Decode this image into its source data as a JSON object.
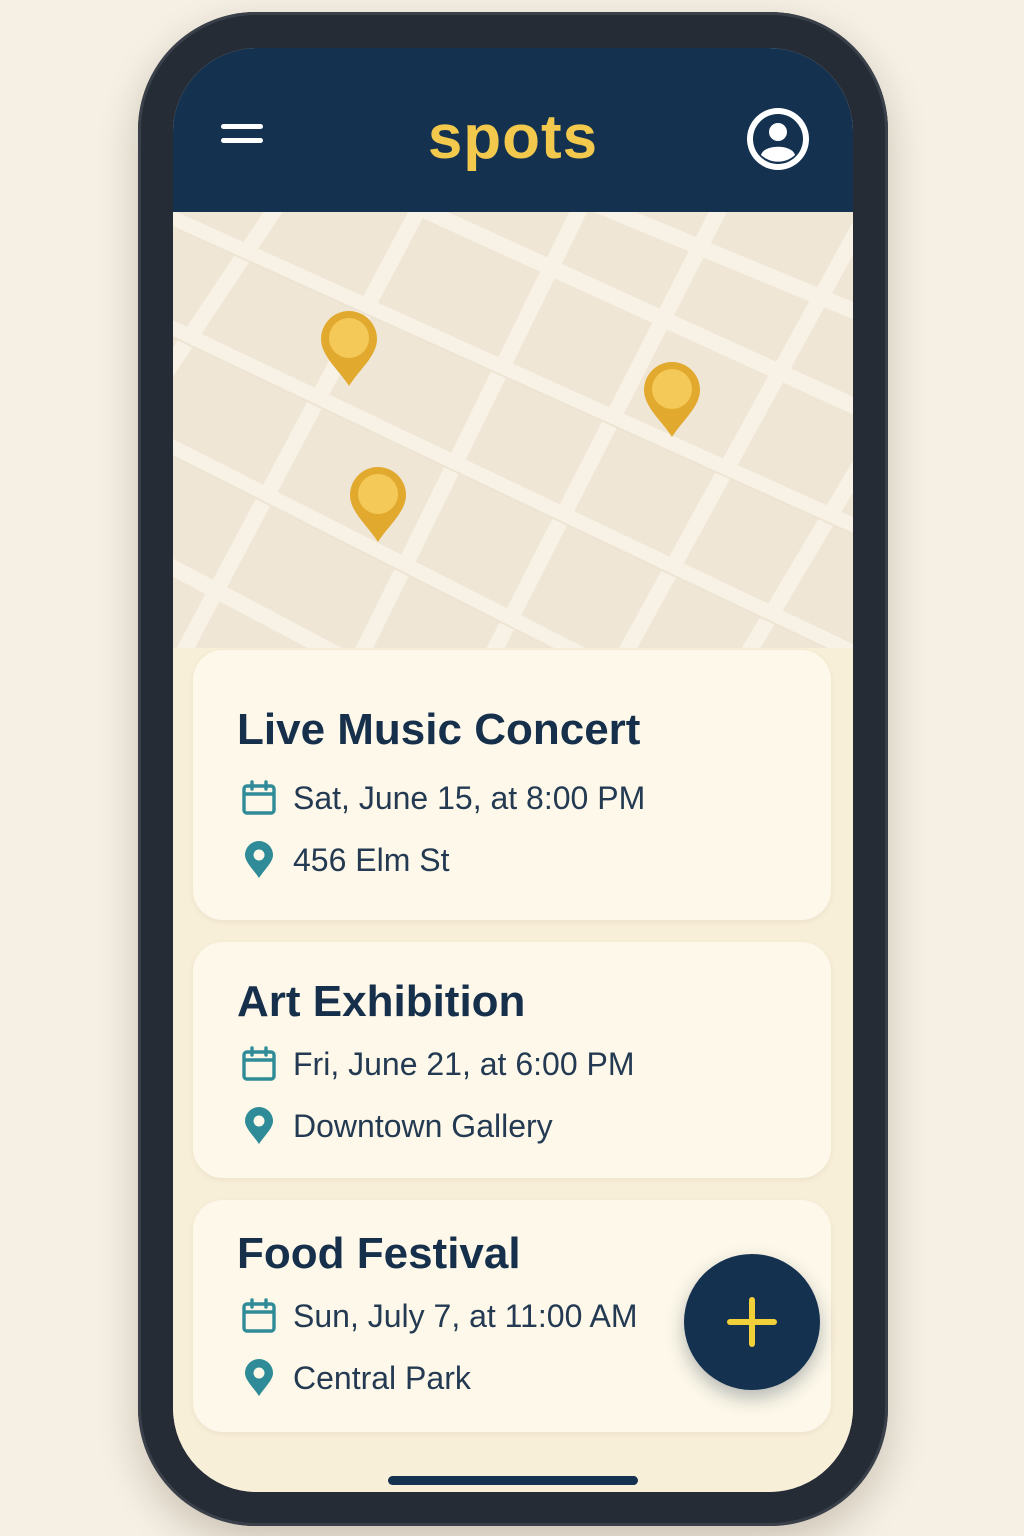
{
  "header": {
    "title": "spots",
    "menu_icon": "hamburger-menu-icon",
    "profile_icon": "user-avatar-icon"
  },
  "map": {
    "pin_icon": "map-pin-icon",
    "pin_count": 3
  },
  "events": [
    {
      "title": "Live Music Concert",
      "datetime": "Sat, June 15, at 8:00 PM",
      "location": "456 Elm St"
    },
    {
      "title": "Art Exhibition",
      "datetime": "Fri, June 21, at 6:00 PM",
      "location": "Downtown Gallery"
    },
    {
      "title": "Food Festival",
      "datetime": "Sun, July 7, at 11:00 AM",
      "location": "Central Park"
    }
  ],
  "icons": {
    "date": "calendar-icon",
    "location": "location-pin-icon",
    "add": "plus-icon"
  },
  "colors": {
    "header_bg": "#14324f",
    "brand_yellow": "#f2c94c",
    "card_bg": "#fdf8e9",
    "screen_bg": "#f8efd9",
    "icon_teal": "#2e8b97",
    "pin_yellow": "#eab53a",
    "title_text": "#16304c"
  }
}
